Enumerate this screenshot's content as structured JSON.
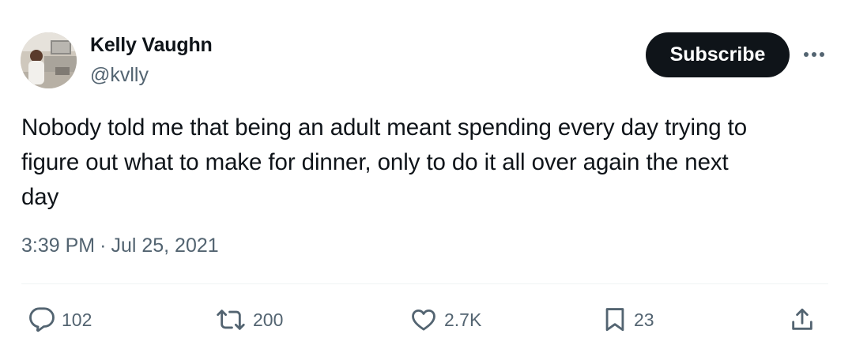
{
  "author": {
    "name": "Kelly Vaughn",
    "handle": "@kvlly",
    "avatar_icon": "profile-photo"
  },
  "subscribe_label": "Subscribe",
  "more_icon": "more-options-icon",
  "tweet_text": "Nobody told me that being an adult meant spending every day trying to\nfigure out what to make for dinner, only to do it all over again the next\nday",
  "meta": {
    "time": "3:39 PM",
    "separator": "·",
    "date": "Jul 25, 2021"
  },
  "actions": {
    "reply": {
      "icon": "reply-icon",
      "count": "102"
    },
    "retweet": {
      "icon": "retweet-icon",
      "count": "200"
    },
    "like": {
      "icon": "heart-icon",
      "count": "2.7K"
    },
    "bookmark": {
      "icon": "bookmark-icon",
      "count": "23"
    },
    "share": {
      "icon": "share-icon"
    }
  },
  "colors": {
    "text": "#0f1419",
    "secondary": "#536471",
    "button_bg": "#0f1419",
    "button_text": "#ffffff",
    "divider": "#eff3f4"
  }
}
